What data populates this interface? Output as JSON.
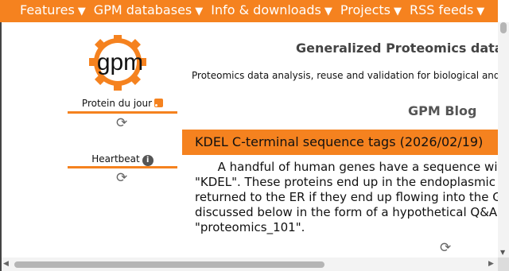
{
  "nav": {
    "items": [
      {
        "label": "Features",
        "arrow": "▼"
      },
      {
        "label": "GPM databases",
        "arrow": "▼"
      },
      {
        "label": "Info & downloads",
        "arrow": "▼"
      },
      {
        "label": "Projects",
        "arrow": "▼"
      },
      {
        "label": "RSS feeds",
        "arrow": "▼"
      }
    ]
  },
  "logo": {
    "text": "gpm"
  },
  "sidebar": {
    "protein_label": "Protein du jour",
    "heartbeat_label": "Heartbeat",
    "info_glyph": "i",
    "refresh_glyph": "⟳"
  },
  "header": {
    "title": "Generalized Proteomics data Mo",
    "subtitle": "Proteomics data analysis, reuse and validation for biological and biom"
  },
  "blog": {
    "title": "GPM Blog",
    "post_title": "KDEL C-terminal sequence tags (2026/02/19)",
    "lines": [
      "      A handful of human genes have a sequence wit",
      "\"KDEL\". These proteins end up in the endoplasmic re",
      "returned to the ER if they end up flowing into the Go",
      "discussed below in the form of a hypothetical Q&A s",
      "\"proteomics_101\"."
    ]
  },
  "colors": {
    "accent": "#f5821f",
    "text": "#111111",
    "heading": "#444444"
  }
}
